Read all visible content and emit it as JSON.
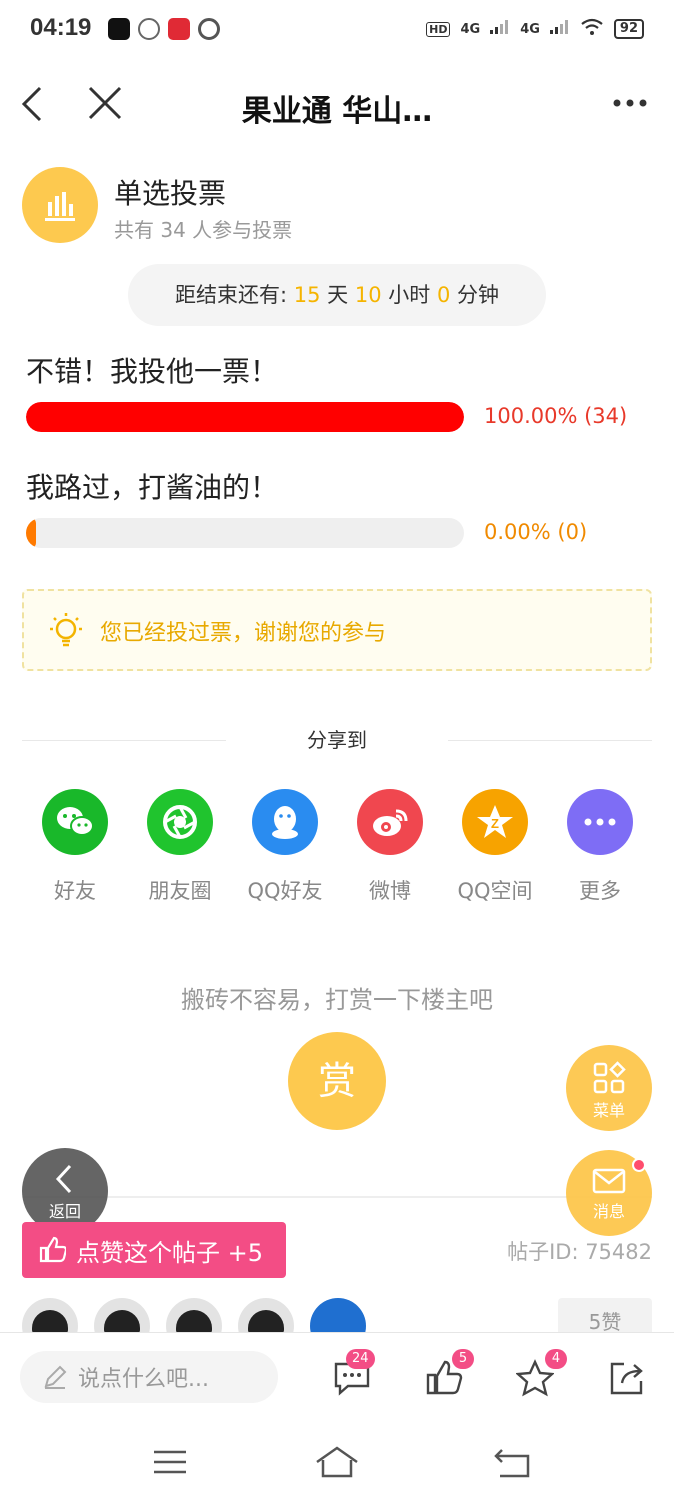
{
  "status_bar": {
    "time": "04:19",
    "network": "4G",
    "battery": "92"
  },
  "header": {
    "title": "果业通 华山…"
  },
  "poll": {
    "type_label": "单选投票",
    "participants": "共有 34 人参与投票",
    "countdown": {
      "prefix": "距结束还有:",
      "days": "15",
      "days_unit": "天",
      "hours": "10",
      "hours_unit": "小时",
      "minutes": "0",
      "minutes_unit": "分钟"
    },
    "options": [
      {
        "label": "不错！我投他一票！",
        "result": "100.00% (34)",
        "fraction": 1.0,
        "color": "#ff0000"
      },
      {
        "label": "我路过，打酱油的！",
        "result": "0.00% (0)",
        "fraction": 0.0,
        "color": "#ff7a00"
      }
    ],
    "voted_notice": "您已经投过票，谢谢您的参与"
  },
  "share": {
    "title": "分享到",
    "items": [
      {
        "label": "好友",
        "icon": "wechat-icon",
        "color": "#19b82a"
      },
      {
        "label": "朋友圈",
        "icon": "moments-icon",
        "color": "#20c42e"
      },
      {
        "label": "QQ好友",
        "icon": "qq-icon",
        "color": "#2a8cf0"
      },
      {
        "label": "微博",
        "icon": "weibo-icon",
        "color": "#f0474f"
      },
      {
        "label": "QQ空间",
        "icon": "qzone-icon",
        "color": "#f7a300"
      },
      {
        "label": "更多",
        "icon": "more-icon",
        "color": "#7e6df5"
      }
    ]
  },
  "reward": {
    "text": "搬砖不容易，打赏一下楼主吧",
    "button": "赏"
  },
  "floating": {
    "menu": "菜单",
    "messages": "消息",
    "back": "返回"
  },
  "post": {
    "like_button": "点赞这个帖子 +5",
    "post_id": "帖子ID: 75482",
    "likes": "5赞"
  },
  "bottom_bar": {
    "comment_placeholder": "说点什么吧...",
    "comments_badge": "24",
    "likes_badge": "5",
    "favorites_badge": "4"
  },
  "colors": {
    "accent_yellow": "#fdc94f",
    "pink": "#f34d85",
    "countdown_number": "#f5b400"
  }
}
